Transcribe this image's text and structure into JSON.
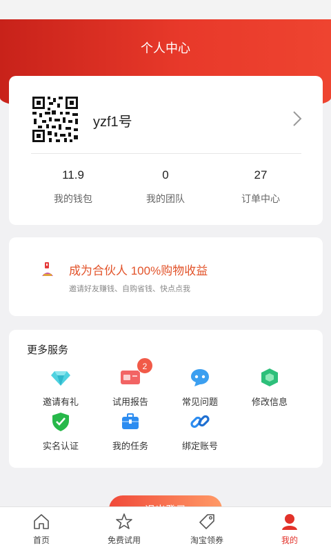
{
  "header": {
    "title": "个人中心"
  },
  "profile": {
    "username": "yzf1号",
    "stats": [
      {
        "value": "11.9",
        "label": "我的钱包"
      },
      {
        "value": "0",
        "label": "我的团队"
      },
      {
        "value": "27",
        "label": "订单中心"
      }
    ]
  },
  "promo": {
    "title": "成为合伙人 100%购物收益",
    "subtitle": "邀请好友赚钱、自购省钱、快点点我"
  },
  "services": {
    "title": "更多服务",
    "items": [
      {
        "label": "邀请有礼",
        "icon": "diamond-icon"
      },
      {
        "label": "试用报告",
        "icon": "card-icon",
        "badge": "2"
      },
      {
        "label": "常见问题",
        "icon": "chat-icon"
      },
      {
        "label": "修改信息",
        "icon": "hexagon-icon"
      },
      {
        "label": "实名认证",
        "icon": "shield-check-icon"
      },
      {
        "label": "我的任务",
        "icon": "briefcase-icon"
      },
      {
        "label": "绑定账号",
        "icon": "link-icon"
      }
    ]
  },
  "logout": {
    "label": "退出登录"
  },
  "tabbar": {
    "items": [
      {
        "label": "首页",
        "icon": "home-icon"
      },
      {
        "label": "免费试用",
        "icon": "star-icon"
      },
      {
        "label": "淘宝领券",
        "icon": "tag-icon"
      },
      {
        "label": "我的",
        "icon": "user-icon"
      }
    ],
    "active_index": 3
  },
  "colors": {
    "accent": "#e2322a",
    "promo_text": "#e2532a"
  }
}
